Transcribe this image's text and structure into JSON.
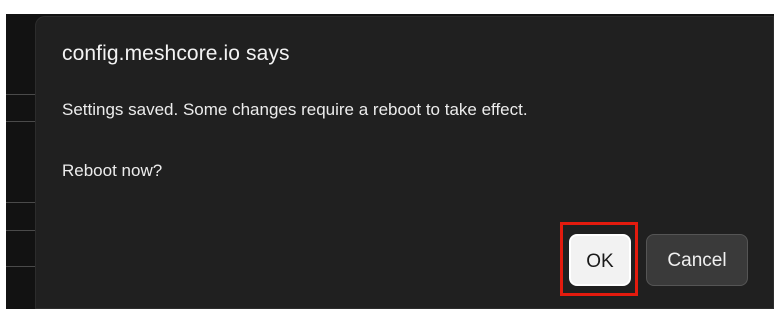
{
  "dialog": {
    "title": "config.meshcore.io says",
    "message": "Settings saved. Some changes require a reboot to take effect.",
    "question": "Reboot now?",
    "buttons": {
      "ok_label": "OK",
      "cancel_label": "Cancel"
    }
  },
  "colors": {
    "dialog_background": "#202020",
    "ok_button_background": "#f2f2f2",
    "cancel_button_background": "#3a3a3a",
    "highlight_outline": "#e31b0e"
  }
}
